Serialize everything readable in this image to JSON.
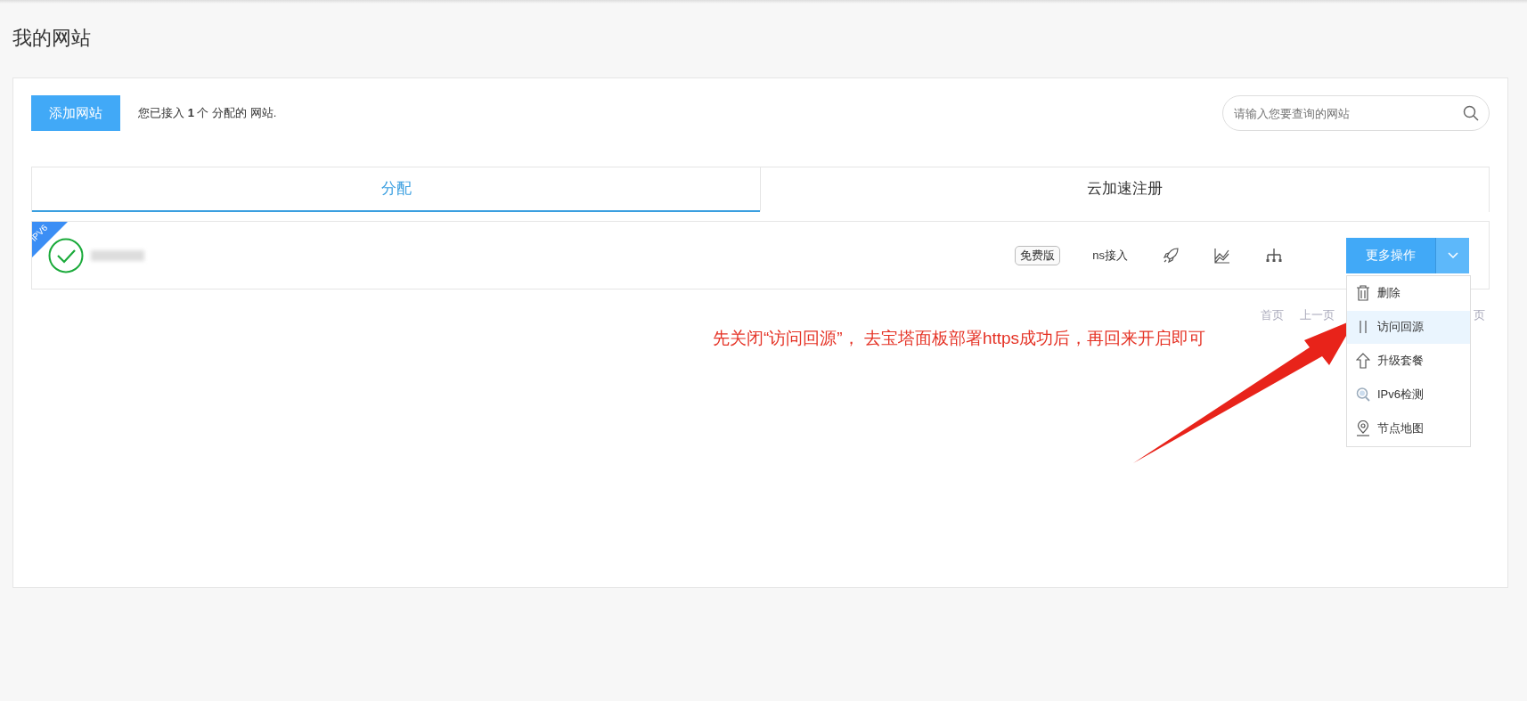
{
  "page_title": "我的网站",
  "toolbar": {
    "add_button": "添加网站",
    "summary": "您已接入 **1** 个 分配的 网站.",
    "search": {
      "placeholder": "请输入您要查询的网站"
    }
  },
  "tabs": [
    {
      "label": "分配",
      "selected": true
    },
    {
      "label": "云加速注册",
      "selected": false
    }
  ],
  "sites": [
    {
      "ribbon": "IPV6",
      "verified": true,
      "plan": "免费版",
      "access": "ns接入",
      "actions_button": "更多操作",
      "expanded": true,
      "menu": [
        {
          "label": "删除",
          "kind": "trash",
          "selected": false
        },
        {
          "label": "访问回源",
          "kind": "pause",
          "selected": true
        },
        {
          "label": "升级套餐",
          "kind": "upgrade",
          "selected": false
        },
        {
          "label": "IPv6检测",
          "kind": "ipcheck",
          "selected": false
        },
        {
          "label": "节点地图",
          "kind": "pin",
          "selected": false
        }
      ]
    }
  ],
  "pagination": [
    "首页",
    "上一页",
    "页"
  ],
  "annotation": "先关闭“访问回源”， 去宝塔面板部署https成功后，再回来开启即可"
}
